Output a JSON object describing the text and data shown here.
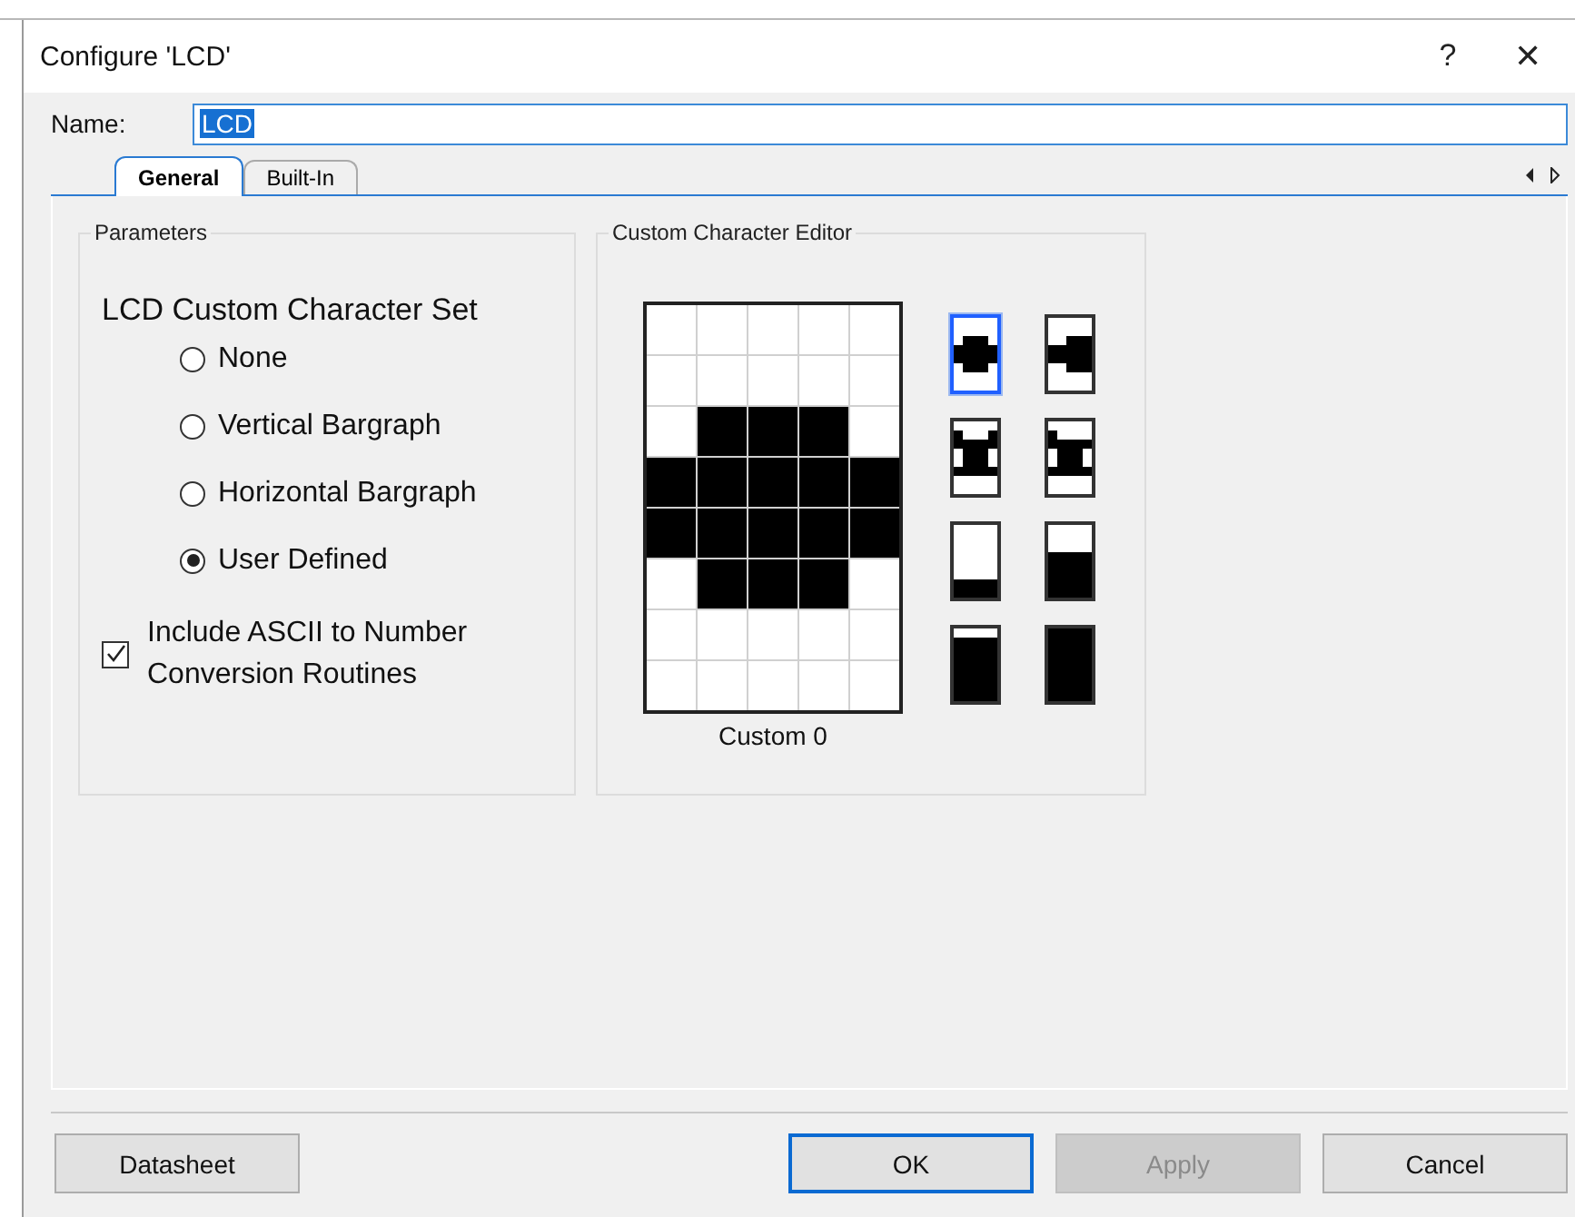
{
  "window": {
    "title": "Configure 'LCD'",
    "help": "?",
    "close": "✕"
  },
  "name_field": {
    "label": "Name:",
    "value": "LCD"
  },
  "tabs": [
    {
      "label": "General",
      "selected": true
    },
    {
      "label": "Built-In",
      "selected": false
    }
  ],
  "parameters": {
    "title": "Parameters",
    "heading": "LCD Custom Character Set",
    "options": [
      {
        "label": "None",
        "selected": false
      },
      {
        "label": "Vertical Bargraph",
        "selected": false
      },
      {
        "label": "Horizontal Bargraph",
        "selected": false
      },
      {
        "label": "User Defined",
        "selected": true
      }
    ],
    "checkbox": {
      "label": "Include ASCII to Number Conversion Routines",
      "checked": true
    }
  },
  "editor": {
    "title": "Custom Character Editor",
    "caption": "Custom 0",
    "pixels": [
      [
        false,
        false,
        false,
        false,
        false
      ],
      [
        false,
        false,
        false,
        false,
        false
      ],
      [
        false,
        true,
        true,
        true,
        false
      ],
      [
        true,
        true,
        true,
        true,
        true
      ],
      [
        true,
        true,
        true,
        true,
        true
      ],
      [
        false,
        true,
        true,
        true,
        false
      ],
      [
        false,
        false,
        false,
        false,
        false
      ],
      [
        false,
        false,
        false,
        false,
        false
      ]
    ],
    "characters": [
      {
        "selected": true,
        "pixels": [
          [
            false,
            false,
            false,
            false,
            false
          ],
          [
            false,
            false,
            false,
            false,
            false
          ],
          [
            false,
            true,
            true,
            true,
            false
          ],
          [
            true,
            true,
            true,
            true,
            true
          ],
          [
            true,
            true,
            true,
            true,
            true
          ],
          [
            false,
            true,
            true,
            true,
            false
          ],
          [
            false,
            false,
            false,
            false,
            false
          ],
          [
            false,
            false,
            false,
            false,
            false
          ]
        ]
      },
      {
        "selected": false,
        "pixels": [
          [
            false,
            false,
            false,
            false,
            false
          ],
          [
            false,
            false,
            false,
            false,
            false
          ],
          [
            false,
            false,
            true,
            true,
            true
          ],
          [
            true,
            true,
            true,
            true,
            true
          ],
          [
            true,
            true,
            true,
            true,
            true
          ],
          [
            false,
            false,
            true,
            true,
            true
          ],
          [
            false,
            false,
            false,
            false,
            false
          ],
          [
            false,
            false,
            false,
            false,
            false
          ]
        ]
      },
      {
        "selected": false,
        "pixels": [
          [
            false,
            false,
            false,
            false,
            false
          ],
          [
            true,
            false,
            false,
            false,
            true
          ],
          [
            true,
            true,
            true,
            true,
            true
          ],
          [
            false,
            true,
            true,
            true,
            false
          ],
          [
            false,
            true,
            true,
            true,
            false
          ],
          [
            true,
            true,
            true,
            true,
            true
          ],
          [
            false,
            false,
            false,
            false,
            false
          ],
          [
            false,
            false,
            false,
            false,
            false
          ]
        ]
      },
      {
        "selected": false,
        "pixels": [
          [
            false,
            false,
            false,
            false,
            false
          ],
          [
            true,
            false,
            false,
            false,
            false
          ],
          [
            true,
            true,
            true,
            true,
            true
          ],
          [
            false,
            true,
            true,
            true,
            false
          ],
          [
            false,
            true,
            true,
            true,
            false
          ],
          [
            true,
            true,
            true,
            true,
            true
          ],
          [
            false,
            false,
            false,
            false,
            false
          ],
          [
            false,
            false,
            false,
            false,
            false
          ]
        ]
      },
      {
        "selected": false,
        "pixels": [
          [
            false,
            false,
            false,
            false,
            false
          ],
          [
            false,
            false,
            false,
            false,
            false
          ],
          [
            false,
            false,
            false,
            false,
            false
          ],
          [
            false,
            false,
            false,
            false,
            false
          ],
          [
            false,
            false,
            false,
            false,
            false
          ],
          [
            false,
            false,
            false,
            false,
            false
          ],
          [
            true,
            true,
            true,
            true,
            true
          ],
          [
            true,
            true,
            true,
            true,
            true
          ]
        ]
      },
      {
        "selected": false,
        "pixels": [
          [
            false,
            false,
            false,
            false,
            false
          ],
          [
            false,
            false,
            false,
            false,
            false
          ],
          [
            false,
            false,
            false,
            false,
            false
          ],
          [
            true,
            true,
            true,
            true,
            true
          ],
          [
            true,
            true,
            true,
            true,
            true
          ],
          [
            true,
            true,
            true,
            true,
            true
          ],
          [
            true,
            true,
            true,
            true,
            true
          ],
          [
            true,
            true,
            true,
            true,
            true
          ]
        ]
      },
      {
        "selected": false,
        "pixels": [
          [
            false,
            false,
            false,
            false,
            false
          ],
          [
            true,
            true,
            true,
            true,
            true
          ],
          [
            true,
            true,
            true,
            true,
            true
          ],
          [
            true,
            true,
            true,
            true,
            true
          ],
          [
            true,
            true,
            true,
            true,
            true
          ],
          [
            true,
            true,
            true,
            true,
            true
          ],
          [
            true,
            true,
            true,
            true,
            true
          ],
          [
            true,
            true,
            true,
            true,
            true
          ]
        ]
      },
      {
        "selected": false,
        "pixels": [
          [
            true,
            true,
            true,
            true,
            true
          ],
          [
            true,
            true,
            true,
            true,
            true
          ],
          [
            true,
            true,
            true,
            true,
            true
          ],
          [
            true,
            true,
            true,
            true,
            true
          ],
          [
            true,
            true,
            true,
            true,
            true
          ],
          [
            true,
            true,
            true,
            true,
            true
          ],
          [
            true,
            true,
            true,
            true,
            true
          ],
          [
            true,
            true,
            true,
            true,
            true
          ]
        ]
      }
    ]
  },
  "buttons": [
    {
      "label": "Datasheet",
      "disabled": false,
      "focused": false
    },
    {
      "label": "OK",
      "disabled": false,
      "focused": true
    },
    {
      "label": "Apply",
      "disabled": true,
      "focused": false
    },
    {
      "label": "Cancel",
      "disabled": false,
      "focused": false
    }
  ]
}
